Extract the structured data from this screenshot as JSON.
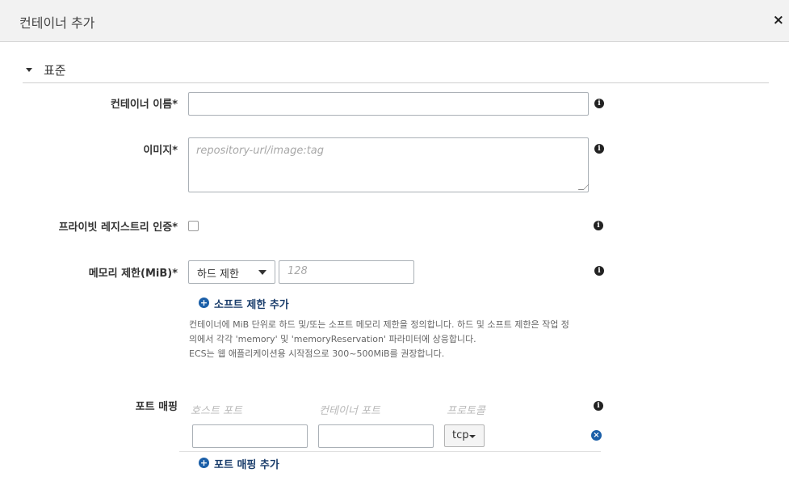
{
  "modal": {
    "title": "컨테이너 추가",
    "close_glyph": "×"
  },
  "section": {
    "title": "표준"
  },
  "fields": {
    "container_name": {
      "label": "컨테이너 이름*",
      "value": ""
    },
    "image": {
      "label": "이미지*",
      "placeholder": "repository-url/image:tag"
    },
    "private_registry": {
      "label": "프라이빗 레지스트리 인증*",
      "checked": false
    },
    "memory": {
      "label": "메모리 제한(MiB)*",
      "limit_type": "하드 제한",
      "placeholder": "128",
      "add_soft_limit": "소프트 제한 추가",
      "help_lines": [
        "컨테이너에 MiB 단위로 하드 및/또는 소프트 메모리 제한을 정의합니다. 하드 및 소프트 제한은 작업 정",
        "의에서 각각 'memory' 및 'memoryReservation' 파라미터에 상응합니다.",
        "ECS는 웹 애플리케이션용 시작점으로 300~500MiB를 권장합니다."
      ]
    },
    "port_mapping": {
      "label": "포트 매핑",
      "columns": [
        "호스트 포트",
        "컨테이너 포트",
        "프로토콜"
      ],
      "rows": [
        {
          "host_port": "",
          "container_port": "",
          "protocol": "tcp"
        }
      ],
      "add_label": "포트 매핑 추가"
    }
  },
  "icons": {
    "info": "i",
    "plus": "+",
    "remove": "×"
  },
  "colors": {
    "header_bg": "#f2f2f2",
    "link": "#1a3d6b",
    "icon_blue": "#1b5fa8"
  }
}
